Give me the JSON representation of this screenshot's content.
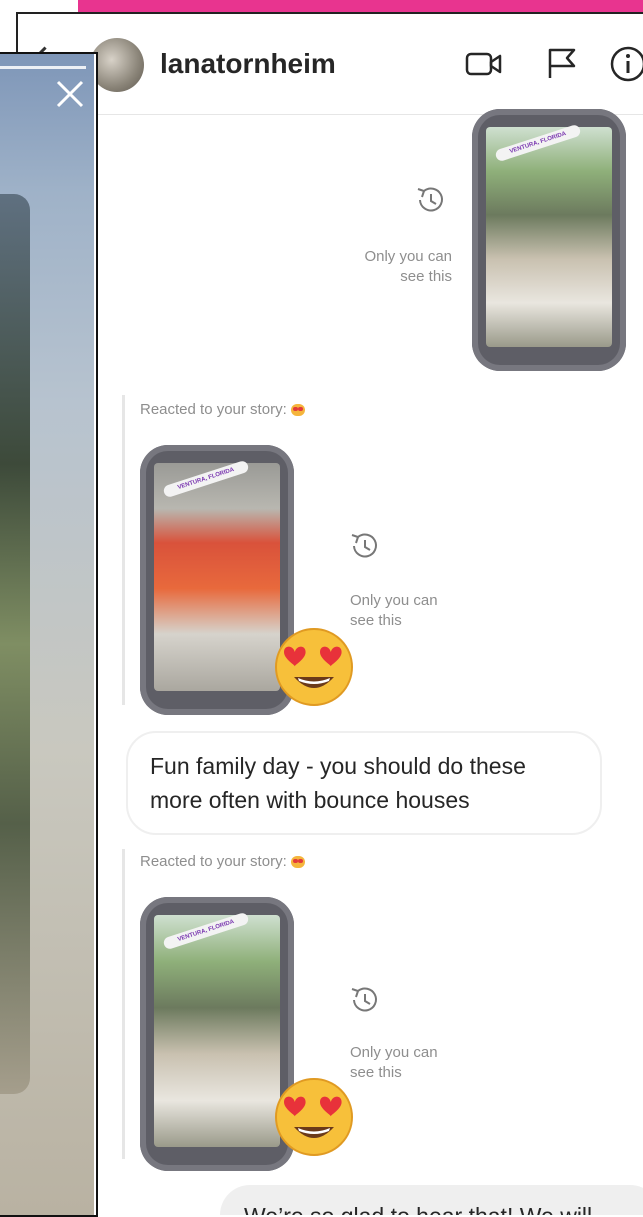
{
  "header": {
    "username": "lanatornheim",
    "icons": [
      "back-icon",
      "video-call-icon",
      "flag-icon",
      "info-icon"
    ]
  },
  "story_viewer": {
    "icons": [
      "close-icon"
    ]
  },
  "thread": {
    "messages": [
      {
        "type": "story_share",
        "note": "Only you can\nsee this"
      },
      {
        "type": "story_reaction",
        "label": "Reacted to your story:",
        "thumb_tag": "VENTURA, FLORIDA",
        "note": "Only you can\nsee this"
      },
      {
        "type": "text_in",
        "text": "Fun family day - you should do these more often with bounce houses"
      },
      {
        "type": "story_reaction",
        "label": "Reacted to your story:",
        "thumb_tag": "VENTURA, FLORIDA",
        "note": "Only you can\nsee this"
      },
      {
        "type": "text_out",
        "text": "We’re so glad to hear that! We will"
      }
    ]
  },
  "colors": {
    "accent_bar": "#e8348f",
    "bubble_out": "#efefef",
    "muted_text": "#8e8e8e"
  }
}
